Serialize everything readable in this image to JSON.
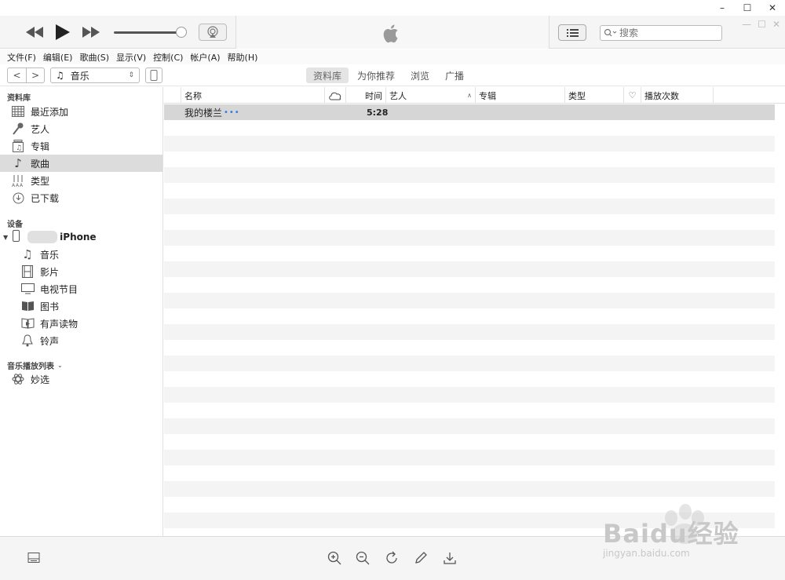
{
  "window": {
    "minimize": "–",
    "maximize": "☐",
    "close": "✕"
  },
  "toolbar": {
    "prev_label": "◀◀",
    "play_label": "▶",
    "next_label": "▶▶",
    "search_placeholder": "搜索"
  },
  "menu": [
    "文件(F)",
    "编辑(E)",
    "歌曲(S)",
    "显示(V)",
    "控制(C)",
    "帐户(A)",
    "帮助(H)"
  ],
  "nav": {
    "back": "<",
    "forward": ">",
    "media_type": "音乐",
    "tabs": [
      {
        "label": "资料库",
        "active": true
      },
      {
        "label": "为你推荐",
        "active": false
      },
      {
        "label": "浏览",
        "active": false
      },
      {
        "label": "广播",
        "active": false
      }
    ]
  },
  "sidebar": {
    "library_title": "资料库",
    "library_items": [
      {
        "label": "最近添加",
        "icon": "grid-icon"
      },
      {
        "label": "艺人",
        "icon": "microphone-icon"
      },
      {
        "label": "专辑",
        "icon": "album-icon"
      },
      {
        "label": "歌曲",
        "icon": "music-note-icon",
        "selected": true
      },
      {
        "label": "类型",
        "icon": "genre-icon"
      },
      {
        "label": "已下载",
        "icon": "download-clock-icon"
      }
    ],
    "devices_title": "设备",
    "device_name": "iPhone",
    "device_items": [
      {
        "label": "音乐",
        "icon": "music-note-icon"
      },
      {
        "label": "影片",
        "icon": "film-icon"
      },
      {
        "label": "电视节目",
        "icon": "tv-icon"
      },
      {
        "label": "图书",
        "icon": "book-icon"
      },
      {
        "label": "有声读物",
        "icon": "audiobook-icon"
      },
      {
        "label": "铃声",
        "icon": "bell-icon"
      }
    ],
    "playlists_title": "音乐播放列表",
    "playlist_items": [
      {
        "label": "妙选",
        "icon": "atom-icon"
      }
    ]
  },
  "table": {
    "headers": {
      "name": "名称",
      "time": "时间",
      "artist": "艺人",
      "album": "专辑",
      "genre": "类型",
      "plays": "播放次数"
    },
    "rows": [
      {
        "name": "我的楼兰",
        "more": "•••",
        "time": "5:28",
        "artist": "",
        "album": "",
        "genre": "",
        "plays": ""
      }
    ]
  },
  "watermark": {
    "text": "Baidu经验",
    "url": "jingyan.baidu.com"
  }
}
